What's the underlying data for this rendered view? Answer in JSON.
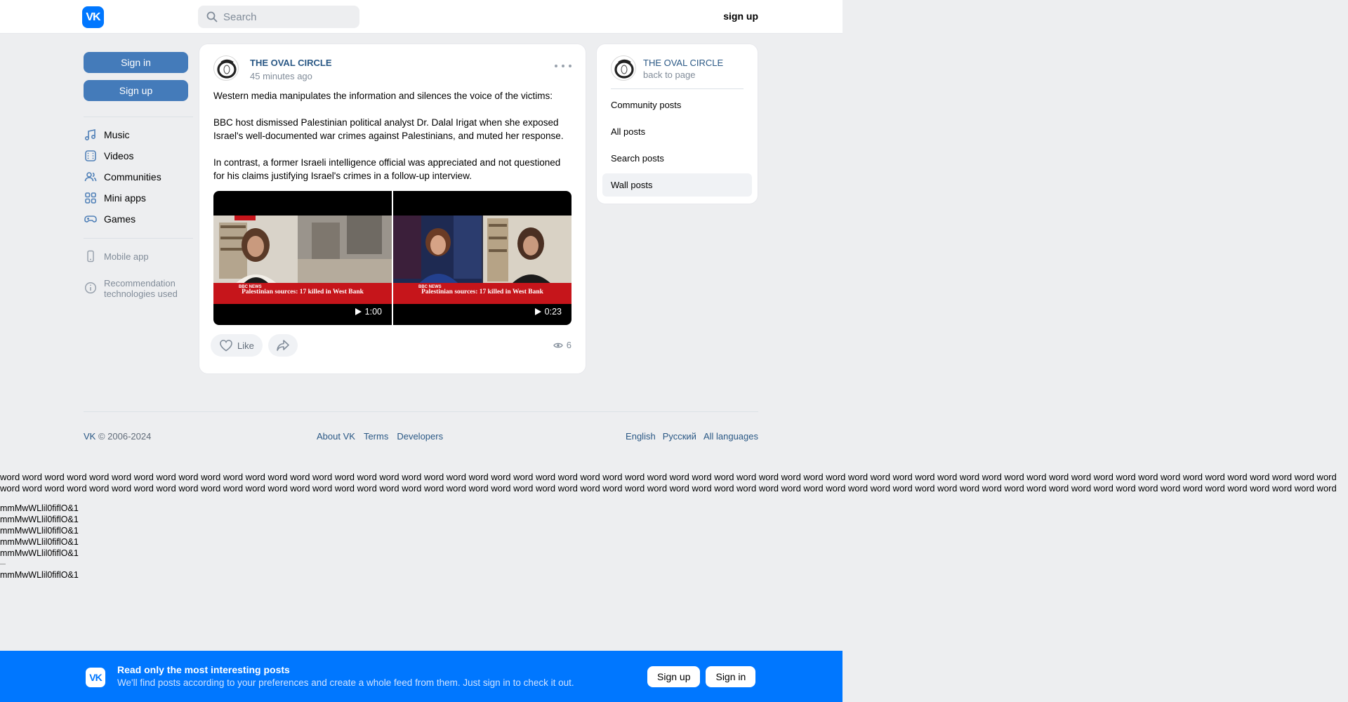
{
  "header": {
    "logo_text": "VK",
    "search_placeholder": "Search",
    "signup_label": "sign up"
  },
  "sidebar": {
    "signin_label": "Sign in",
    "signup_label": "Sign up",
    "nav": [
      {
        "label": "Music",
        "icon": "music-icon"
      },
      {
        "label": "Videos",
        "icon": "video-icon"
      },
      {
        "label": "Communities",
        "icon": "people-icon"
      },
      {
        "label": "Mini apps",
        "icon": "apps-icon"
      },
      {
        "label": "Games",
        "icon": "gamepad-icon"
      }
    ],
    "mobile_app": "Mobile app",
    "recommendation_line1": "Recommendation",
    "recommendation_line2": "technologies used"
  },
  "post": {
    "author": "THE OVAL CIRCLE",
    "time": "45 minutes ago",
    "paragraphs": [
      "Western media manipulates the information and silences the voice of the victims:",
      "BBC host dismissed Palestinian political analyst Dr. Dalal Irigat when she exposed Israel's well-documented war crimes against Palestinians, and muted her response.",
      "In contrast, a former Israeli intelligence official was appreciated and not questioned for his claims justifying Israel's crimes in a follow-up interview."
    ],
    "videos": [
      {
        "duration": "1:00",
        "headline": "Palestinian sources: 17 killed in West Bank",
        "channel": "BBC NEWS"
      },
      {
        "duration": "0:23",
        "headline": "Palestinian sources: 17 killed in West Bank",
        "channel": "BBC NEWS"
      }
    ],
    "like_label": "Like",
    "views": "6"
  },
  "side_card": {
    "name": "THE OVAL CIRCLE",
    "back_label": "back to page",
    "menu": [
      "Community posts",
      "All posts",
      "Search posts",
      "Wall posts"
    ],
    "active_index": 3
  },
  "footer": {
    "copyright_prefix": "VK",
    "copyright_rest": " © 2006-2024",
    "links": [
      "About VK",
      "Terms",
      "Developers"
    ],
    "languages": [
      "English",
      "Русский",
      "All languages"
    ]
  },
  "test_text": {
    "words": "word word word word word word word word word word word word word word word word word word word word word word word word word word word word word word word word word word word word word word word word word word word word word word word word word word word word word word word word word word word word word word word word word word word word word word word word word word word word word word word word word word word word word word word word word word word word word word word word word word word word word word word word word word word word word word word word word word word word word word word word word word word word word word word word word word word word word word word word word word word word word word word word word word word word word word word",
    "glyphs": "mmMwWLlil0fiflO&1"
  },
  "banner": {
    "logo_text": "VK",
    "title": "Read only the most interesting posts",
    "subtitle": "We'll find posts according to your preferences and create a whole feed from them. Just sign in to check it out.",
    "signup_label": "Sign up",
    "signin_label": "Sign in"
  },
  "colors": {
    "brand": "#0077ff",
    "button": "#447bba",
    "link": "#2a5885",
    "muted": "#818c99",
    "page_bg": "#edeef0"
  }
}
